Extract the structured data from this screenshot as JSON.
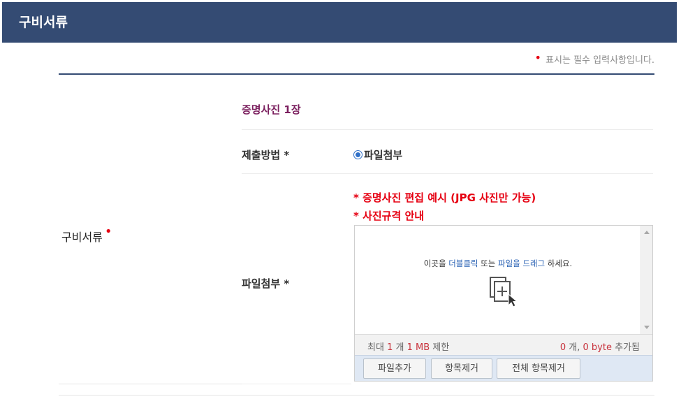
{
  "header": {
    "title": "구비서류"
  },
  "required_note": {
    "dot": "•",
    "text": "표시는 필수 입력사항입니다."
  },
  "row": {
    "label": "구비서류",
    "required_mark": "•"
  },
  "section": {
    "subtitle": "증명사진 1장"
  },
  "method": {
    "label": "제출방법 *",
    "option": "파일첨부",
    "selected": true
  },
  "file": {
    "label": "파일첨부 *",
    "guide_1": "* 증명사진 편집 예시 (JPG 사진만 가능)",
    "guide_2": "* 사진규격 안내"
  },
  "uploader": {
    "drop_prefix": "이곳을 ",
    "drop_dblclick": "더블클릭",
    "drop_middle": " 또는 ",
    "drop_drag": "파일을 드래그",
    "drop_suffix": " 하세요.",
    "limit_prefix": "최대 ",
    "limit_count": "1",
    "limit_mid": " 개 ",
    "limit_size": "1 MB",
    "limit_suffix": " 제한",
    "added_count": "0",
    "added_mid": " 개, ",
    "added_size": "0 byte",
    "added_suffix": " 추가됨",
    "buttons": {
      "add": "파일추가",
      "remove": "항목제거",
      "remove_all": "전체 항목제거"
    }
  },
  "colors": {
    "header_bg": "#344b73",
    "accent_red": "#e60012",
    "subtitle": "#7b1f5e",
    "link_blue": "#2a62b4"
  }
}
